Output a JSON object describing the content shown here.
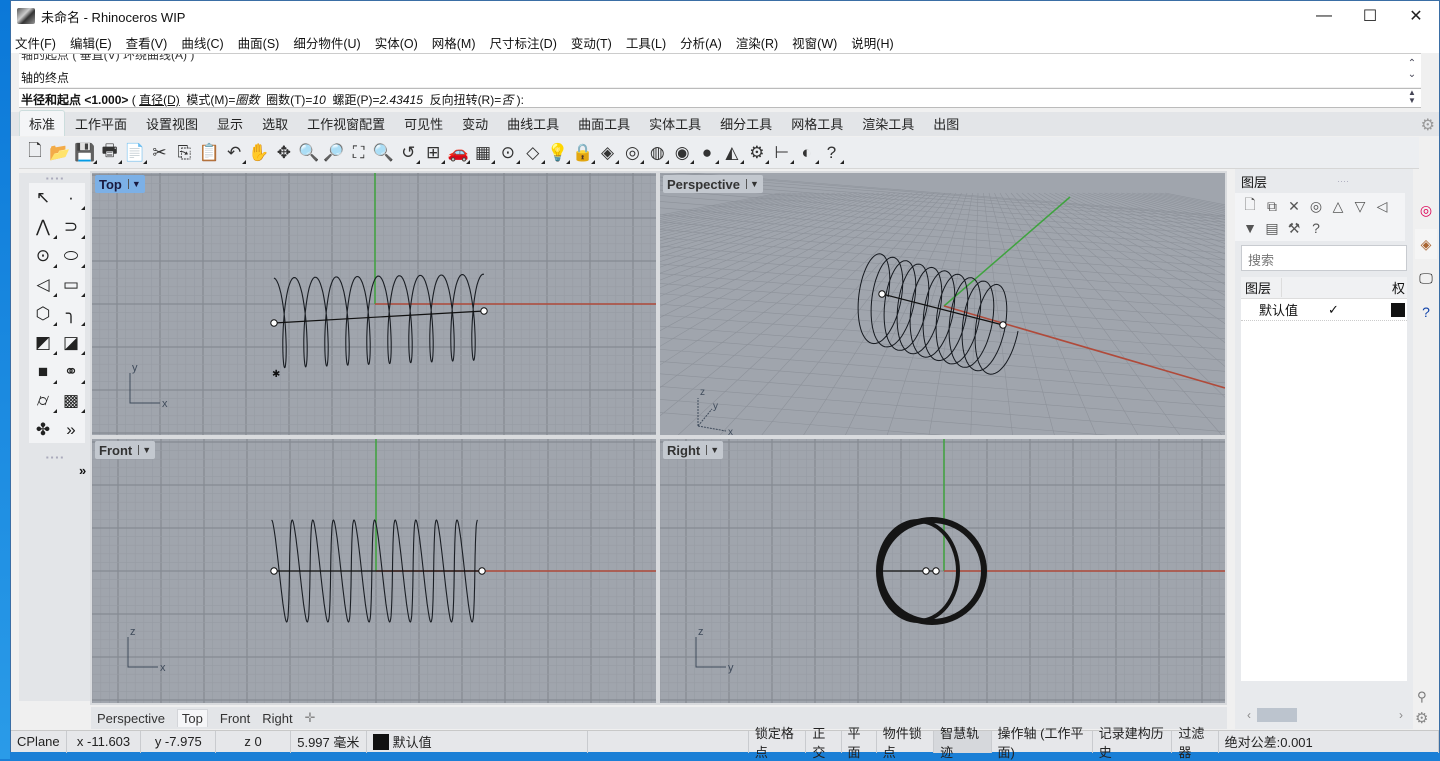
{
  "window": {
    "title": "未命名 - Rhinoceros WIP",
    "controls": {
      "minimize": "—",
      "maximize": "☐",
      "close": "✕"
    }
  },
  "menu": [
    "文件(F)",
    "编辑(E)",
    "查看(V)",
    "曲线(C)",
    "曲面(S)",
    "细分物件(U)",
    "实体(O)",
    "网格(M)",
    "尺寸标注(D)",
    "变动(T)",
    "工具(L)",
    "分析(A)",
    "渲染(R)",
    "视窗(W)",
    "说明(H)"
  ],
  "command": {
    "history_line1": "轴的起点 ( 垂直(V)  环绕曲线(A) )",
    "history_line2": "轴的终点",
    "prompt": "半径和起点",
    "default": "<1.000>",
    "options_open": " ( ",
    "opt_diameter": "直径(D)",
    "opt_mode_label": "模式(M)=",
    "opt_mode_value": "圈数",
    "opt_turns_label": "圈数(T)=",
    "opt_turns_value": "10",
    "opt_pitch_label": "螺距(P)=",
    "opt_pitch_value": "2.43415",
    "opt_reverse_label": "反向扭转(R)=",
    "opt_reverse_value": "否",
    "options_close": " ):"
  },
  "toolbar_tabs": [
    "标准",
    "工作平面",
    "设置视图",
    "显示",
    "选取",
    "工作视窗配置",
    "可见性",
    "变动",
    "曲线工具",
    "曲面工具",
    "实体工具",
    "细分工具",
    "网格工具",
    "渲染工具",
    "出图"
  ],
  "active_toolbar_tab": "标准",
  "toolbar_icons": [
    {
      "name": "new-file-icon",
      "glyph": "🗋"
    },
    {
      "name": "open-folder-icon",
      "glyph": "📂"
    },
    {
      "name": "save-icon",
      "glyph": "💾"
    },
    {
      "name": "print-icon",
      "glyph": "🖶"
    },
    {
      "name": "import-icon",
      "glyph": "📄"
    },
    {
      "name": "cut-icon",
      "glyph": "✂"
    },
    {
      "name": "copy-icon",
      "glyph": "⎘"
    },
    {
      "name": "paste-icon",
      "glyph": "📋"
    },
    {
      "name": "undo-icon",
      "glyph": "↶"
    },
    {
      "name": "pan-hand-icon",
      "glyph": "✋"
    },
    {
      "name": "rotate-view-icon",
      "glyph": "✥"
    },
    {
      "name": "zoom-dynamic-icon",
      "glyph": "🔍"
    },
    {
      "name": "zoom-window-icon",
      "glyph": "🔎"
    },
    {
      "name": "zoom-extents-icon",
      "glyph": "⛶"
    },
    {
      "name": "zoom-selected-icon",
      "glyph": "🔍"
    },
    {
      "name": "undo-view-icon",
      "glyph": "↺"
    },
    {
      "name": "four-viewports-icon",
      "glyph": "⊞"
    },
    {
      "name": "named-views-car-icon",
      "glyph": "🚗"
    },
    {
      "name": "cplane-icon",
      "glyph": "▦"
    },
    {
      "name": "osnap-point-icon",
      "glyph": "⊙"
    },
    {
      "name": "select-objects-icon",
      "glyph": "◇"
    },
    {
      "name": "light-bulb-icon",
      "glyph": "💡"
    },
    {
      "name": "lock-icon",
      "glyph": "🔒"
    },
    {
      "name": "layer-icon",
      "glyph": "◈"
    },
    {
      "name": "color-wheel-icon",
      "glyph": "◎"
    },
    {
      "name": "wireframe-sphere-icon",
      "glyph": "◍"
    },
    {
      "name": "shaded-sphere-grid-icon",
      "glyph": "◉"
    },
    {
      "name": "rendered-sphere-icon",
      "glyph": "●"
    },
    {
      "name": "spotlight-icon",
      "glyph": "◭"
    },
    {
      "name": "options-gears-icon",
      "glyph": "⚙"
    },
    {
      "name": "dimension-icon",
      "glyph": "⊢"
    },
    {
      "name": "environment-icon",
      "glyph": "◐"
    },
    {
      "name": "help-icon",
      "glyph": "?"
    }
  ],
  "left_tools": [
    {
      "name": "select-arrow-icon",
      "glyph": "↖",
      "sub": false
    },
    {
      "name": "point-icon",
      "glyph": "·",
      "sub": true
    },
    {
      "name": "polyline-icon",
      "glyph": "⋀",
      "sub": true
    },
    {
      "name": "curve-icon",
      "glyph": "⊃",
      "sub": true
    },
    {
      "name": "circle-icon",
      "glyph": "⊙",
      "sub": true
    },
    {
      "name": "ellipse-icon",
      "glyph": "⬭",
      "sub": true
    },
    {
      "name": "arc-icon",
      "glyph": "◁",
      "sub": true
    },
    {
      "name": "rectangle-icon",
      "glyph": "▭",
      "sub": true
    },
    {
      "name": "polygon-icon",
      "glyph": "⬡",
      "sub": true
    },
    {
      "name": "fillet-curve-icon",
      "glyph": "╮",
      "sub": true
    },
    {
      "name": "surface-from-points-icon",
      "glyph": "◩",
      "sub": true
    },
    {
      "name": "extrude-surface-icon",
      "glyph": "◪",
      "sub": true
    },
    {
      "name": "box-solid-icon",
      "glyph": "■",
      "sub": true
    },
    {
      "name": "boolean-spheres-icon",
      "glyph": "⚭",
      "sub": true
    },
    {
      "name": "cylinder-mesh-icon",
      "glyph": "⌭",
      "sub": true
    },
    {
      "name": "mesh-surface-icon",
      "glyph": "▩",
      "sub": true
    },
    {
      "name": "puzzle-plugins-icon",
      "glyph": "✤",
      "sub": false
    },
    {
      "name": "more-tools-icon",
      "glyph": "»",
      "sub": false
    }
  ],
  "left_expand": "»",
  "viewports": {
    "top": {
      "label": "Top",
      "axes": [
        "x",
        "y"
      ]
    },
    "perspective": {
      "label": "Perspective",
      "axes": [
        "x",
        "y",
        "z"
      ]
    },
    "front": {
      "label": "Front",
      "axes": [
        "x",
        "z"
      ]
    },
    "right": {
      "label": "Right",
      "axes": [
        "y",
        "z"
      ]
    },
    "active": "Top",
    "helix_turns": 10
  },
  "viewport_tabs": [
    "Perspective",
    "Top",
    "Front",
    "Right"
  ],
  "viewport_tab_selected": "Top",
  "viewport_tab_add": "✛",
  "layers_panel": {
    "title": "图层",
    "grip": "····",
    "search_placeholder": "搜索",
    "column_header": "图层",
    "column_header_right": "权",
    "layers": [
      {
        "name": "默认值",
        "current": "✓",
        "color": "#111111"
      }
    ],
    "buttons": [
      "new-layer-icon",
      "new-sublayer-icon",
      "delete-layer-icon",
      "select-objects-icon",
      "move-up-icon",
      "move-down-icon",
      "move-left-icon",
      "filter-icon",
      "layer-states-icon",
      "tools-hammer-icon",
      "help-icon"
    ],
    "button_glyphs": [
      "🗋",
      "⧉",
      "✕",
      "◎",
      "△",
      "▽",
      "◁",
      "▼",
      "▤",
      "⚒",
      "?"
    ]
  },
  "side_tabs": [
    "color-wheel-icon",
    "layers-tab-icon",
    "display-tab-icon",
    "help-tab-icon"
  ],
  "status": {
    "cplane": "CPlane",
    "x": "x -11.603",
    "y": "y -7.975",
    "z": "z 0",
    "distance": "5.997 毫米",
    "layer": "默认值",
    "layer_color": "#111111",
    "toggles": [
      "锁定格点",
      "正交",
      "平面",
      "物件锁点",
      "智慧轨迹",
      "操作轴 (工作平面)",
      "记录建构历史",
      "过滤器"
    ],
    "tolerance": "绝对公差:0.001"
  },
  "colors": {
    "viewport_bg": "#a0a5ad",
    "grid_minor": "#979ca4",
    "grid_major": "#858a92",
    "x_axis": "#b04a3a",
    "y_axis": "#3fa33f",
    "active_label": "#7cb0e6"
  }
}
